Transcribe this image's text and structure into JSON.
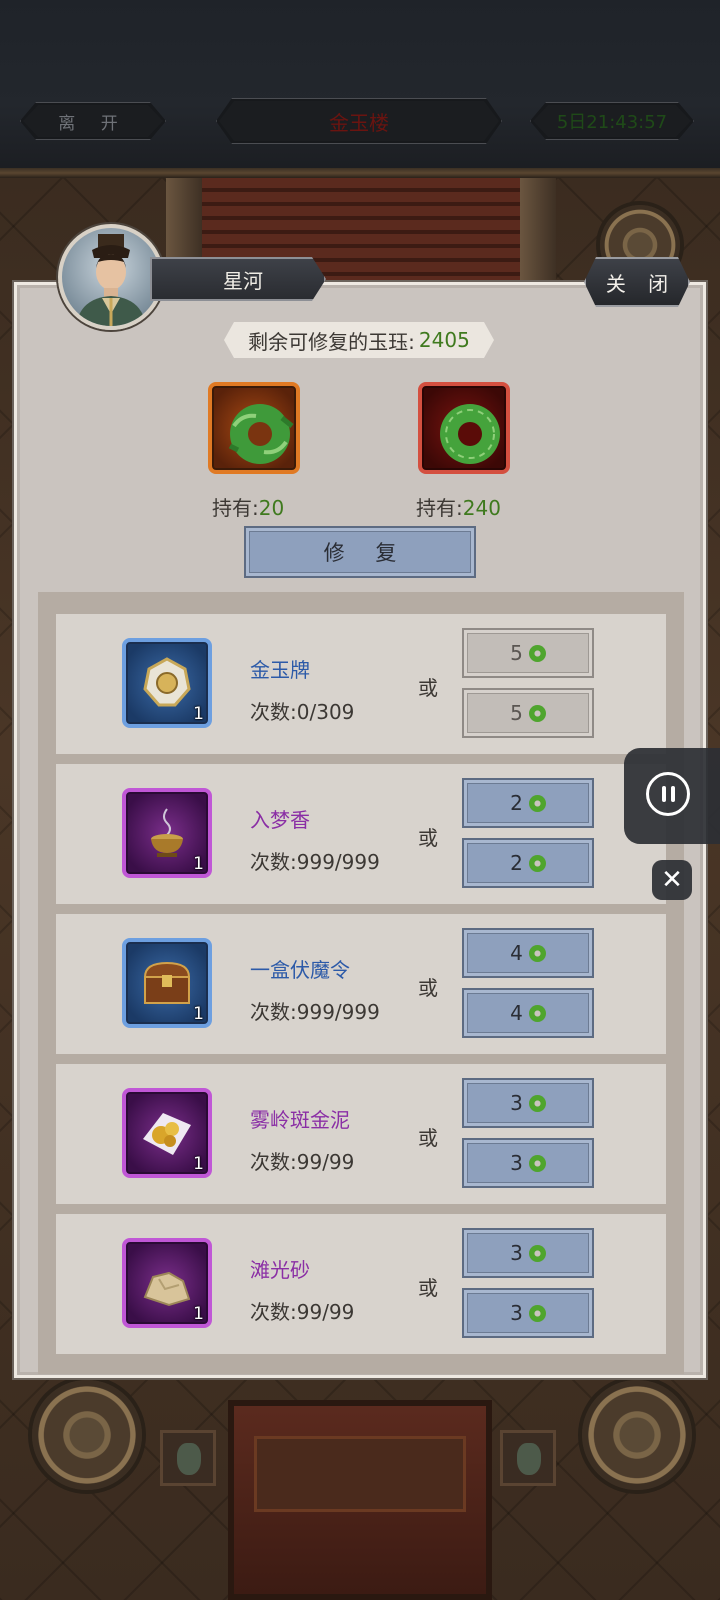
{
  "top_bar": {
    "leave_label": "离 开",
    "location": "金玉楼",
    "timer": "5日21:43:57"
  },
  "dialog": {
    "player_name": "星河",
    "close_label": "关 闭",
    "remain_label": "剩余可修复的玉珏:",
    "remain_value": "2405",
    "jade_slots": [
      {
        "hold_label": "持有:",
        "hold_value": "20",
        "frame_color": "#e07a24"
      },
      {
        "hold_label": "持有:",
        "hold_value": "240",
        "frame_color": "#d45040"
      }
    ],
    "repair_label": "修 复",
    "or_label": "或",
    "items": [
      {
        "name": "金玉牌",
        "count_label": "次数:",
        "count": "0/309",
        "qty": "1",
        "rarity": "blue",
        "icon": "jade-plaque-icon",
        "cost1": "5",
        "cost2": "5",
        "disabled": true
      },
      {
        "name": "入梦香",
        "count_label": "次数:",
        "count": "999/999",
        "qty": "1",
        "rarity": "purple",
        "icon": "incense-burner-icon",
        "cost1": "2",
        "cost2": "2",
        "disabled": false
      },
      {
        "name": "一盒伏魔令",
        "count_label": "次数:",
        "count": "999/999",
        "qty": "1",
        "rarity": "blue",
        "icon": "treasure-chest-icon",
        "cost1": "4",
        "cost2": "4",
        "disabled": false
      },
      {
        "name": "雾岭斑金泥",
        "count_label": "次数:",
        "count": "99/99",
        "qty": "1",
        "rarity": "purple",
        "icon": "gold-mud-icon",
        "cost1": "3",
        "cost2": "3",
        "disabled": false
      },
      {
        "name": "滩光砂",
        "count_label": "次数:",
        "count": "99/99",
        "qty": "1",
        "rarity": "purple",
        "icon": "sand-stone-icon",
        "cost1": "3",
        "cost2": "3",
        "disabled": false
      }
    ]
  },
  "floating": {
    "pause_icon": "pause-icon",
    "close_icon": "close-icon",
    "close_glyph": "✕"
  },
  "colors": {
    "green_value": "#3f7a1e",
    "blue_rarity": "#2c5aa8",
    "purple_rarity": "#8a2ea5",
    "button_blue": "#8ea0bd"
  }
}
